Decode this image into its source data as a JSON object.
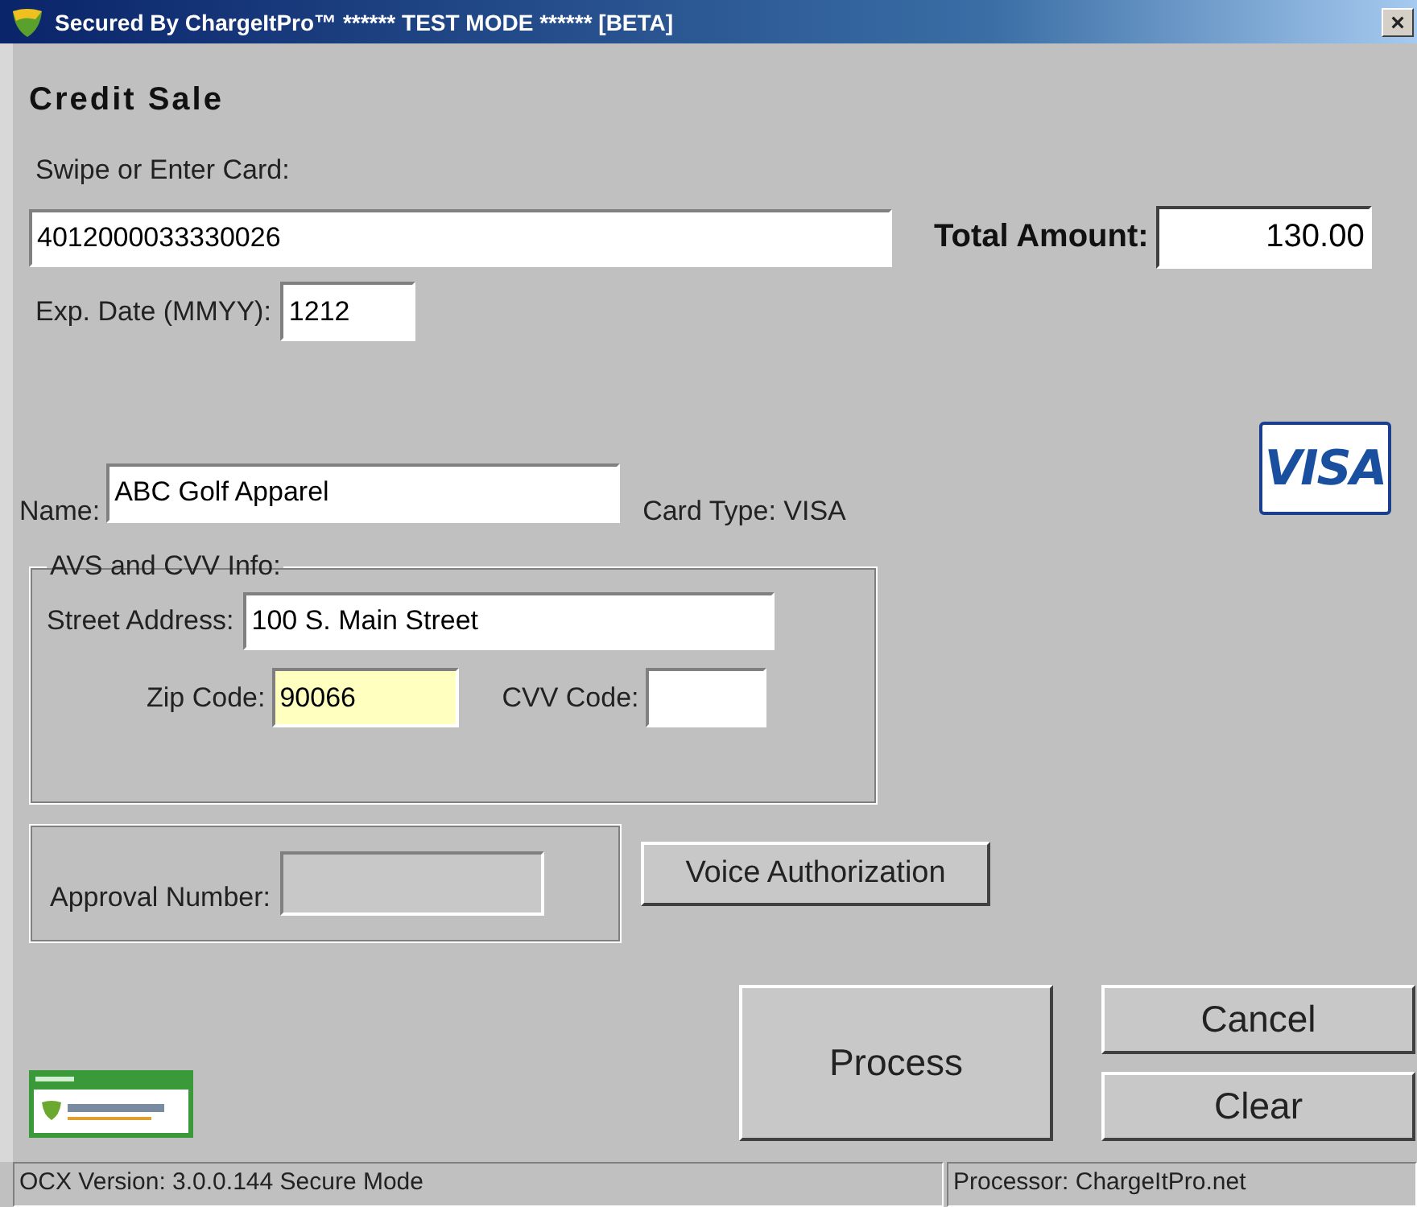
{
  "window": {
    "title": "Secured By ChargeItPro™ ****** TEST MODE ****** [BETA]",
    "close": "×"
  },
  "heading": "Credit Sale",
  "card": {
    "label": "Swipe or Enter Card:",
    "value": "4012000033330026"
  },
  "total": {
    "label": "Total Amount:",
    "value": "130.00"
  },
  "exp": {
    "label": "Exp. Date (MMYY):",
    "value": "1212"
  },
  "card_logo": "VISA",
  "name": {
    "label": "Name:",
    "value": "ABC Golf Apparel"
  },
  "card_type": "Card Type: VISA",
  "avs": {
    "legend": "AVS and CVV Info:",
    "street": {
      "label": "Street Address:",
      "value": "100 S. Main Street",
      "focused": false
    },
    "zip": {
      "label": "Zip Code:",
      "value": "90066",
      "focused": true
    },
    "cvv": {
      "label": "CVV Code:",
      "focused": false
    }
  },
  "approval": {
    "label": "Approval Number:",
    "disabled": true
  },
  "buttons": [
    {
      "kind": "voice",
      "label": "Voice Authorization"
    },
    {
      "kind": "process",
      "label": "Process"
    },
    {
      "kind": "cancel",
      "label": "Cancel"
    },
    {
      "kind": "clear",
      "label": "Clear"
    }
  ],
  "status_bar": {
    "left": "OCX Version: 3.0.0.144  Secure Mode",
    "right": "Processor: ChargeItPro.net"
  }
}
